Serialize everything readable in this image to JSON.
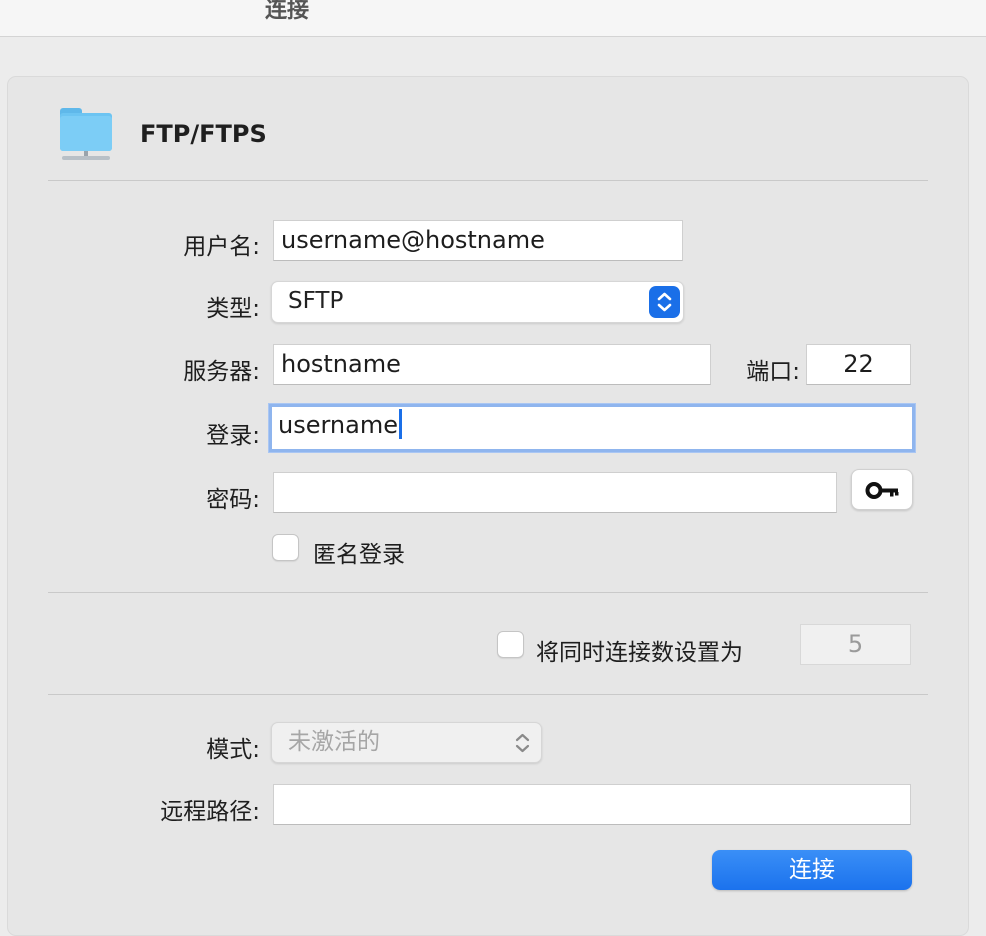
{
  "window": {
    "title": "连接"
  },
  "protocol": {
    "name": "FTP/FTPS",
    "icon": "folder-network-icon"
  },
  "form": {
    "username_label": "用户名:",
    "username_value": "username@hostname",
    "type_label": "类型:",
    "type_value": "SFTP",
    "server_label": "服务器:",
    "server_value": "hostname",
    "port_label": "端口:",
    "port_value": "22",
    "login_label": "登录:",
    "login_value": "username",
    "password_label": "密码:",
    "password_value": "",
    "key_icon": "key-icon",
    "anonymous_label": "匿名登录",
    "anonymous_checked": false
  },
  "connections": {
    "limit_label": "将同时连接数设置为",
    "limit_checked": false,
    "limit_value": "5"
  },
  "advanced": {
    "mode_label": "模式:",
    "mode_value": "未激活的",
    "remote_path_label": "远程路径:",
    "remote_path_value": ""
  },
  "actions": {
    "connect_label": "连接"
  },
  "colors": {
    "accent": "#1a6fe8",
    "focus_ring": "#8fb5ee",
    "folder": "#6cc4f2"
  }
}
